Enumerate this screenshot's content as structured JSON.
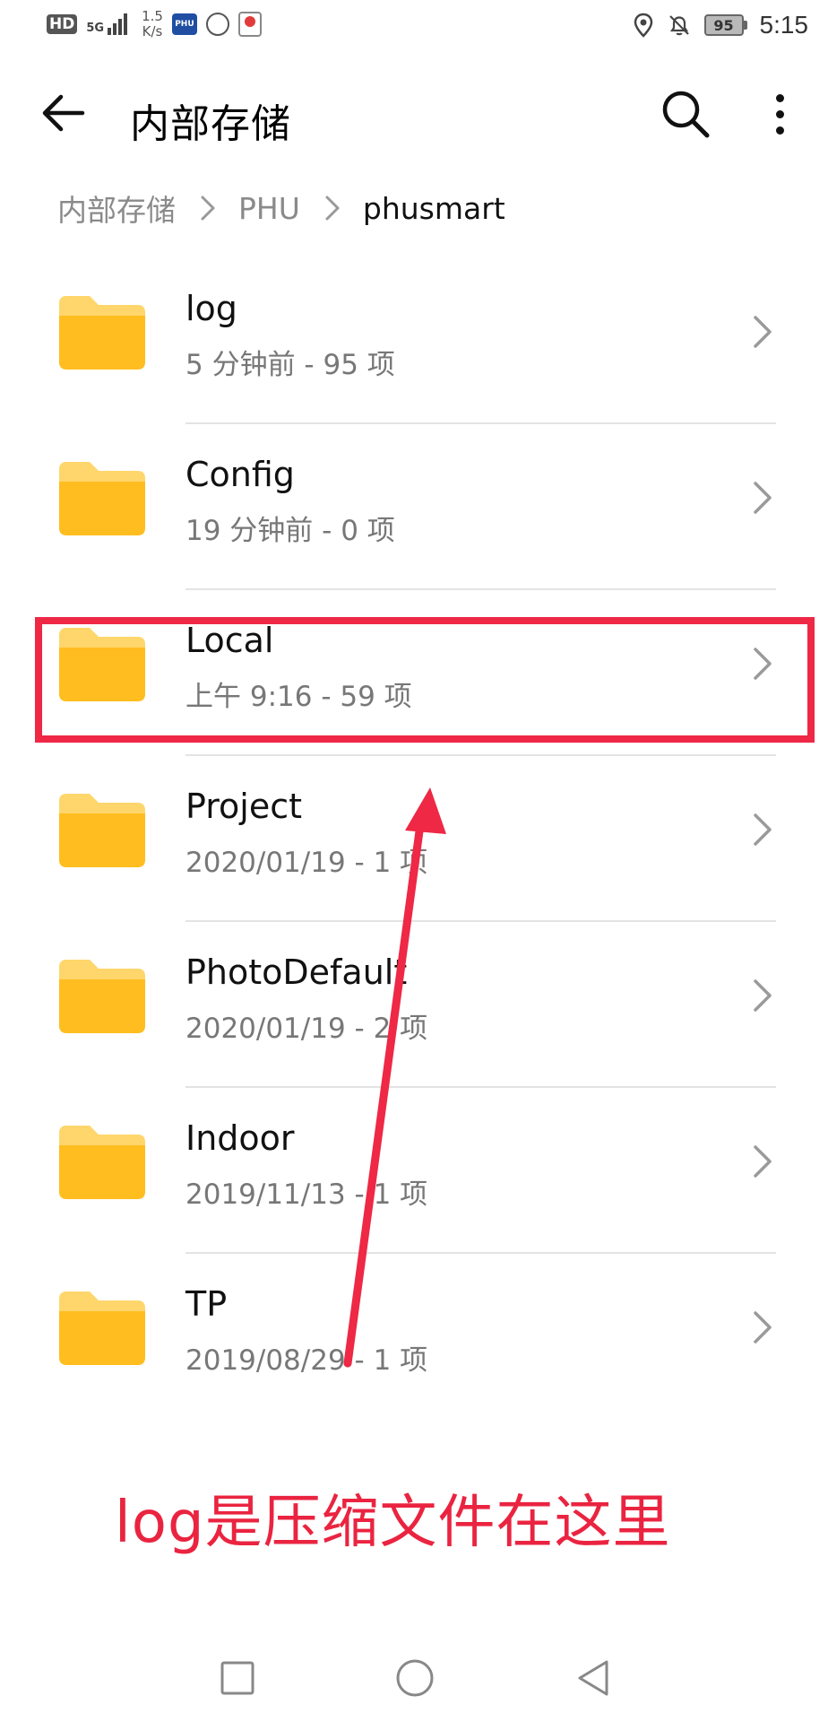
{
  "status_bar": {
    "hd": "HD",
    "network": "5G",
    "speed_value": "1.5",
    "speed_unit": "K/s",
    "phu_label": "PHU",
    "battery": "95",
    "time": "5:15"
  },
  "app_bar": {
    "title": "内部存储",
    "back_icon": "arrow-left",
    "search_icon": "search",
    "more_icon": "more-vertical"
  },
  "breadcrumb": [
    "内部存储",
    "PHU",
    "phusmart"
  ],
  "folders": [
    {
      "name": "log",
      "meta": "5 分钟前 - 95 项"
    },
    {
      "name": "Config",
      "meta": "19 分钟前 - 0 项"
    },
    {
      "name": "Local",
      "meta": "上午 9:16  - 59 项"
    },
    {
      "name": "Project",
      "meta": "2020/01/19 - 1 项"
    },
    {
      "name": "PhotoDefault",
      "meta": "2020/01/19 - 2 项"
    },
    {
      "name": "Indoor",
      "meta": "2019/11/13 - 1 项"
    },
    {
      "name": "TP",
      "meta": "2019/08/29 - 1 项"
    }
  ],
  "annotation": {
    "text": "log是压缩文件在这里",
    "color": "#ea2440"
  },
  "colors": {
    "folder": "#ffbd1f",
    "folder_tab": "#ffd66b",
    "annotation_red": "#ee2845"
  }
}
